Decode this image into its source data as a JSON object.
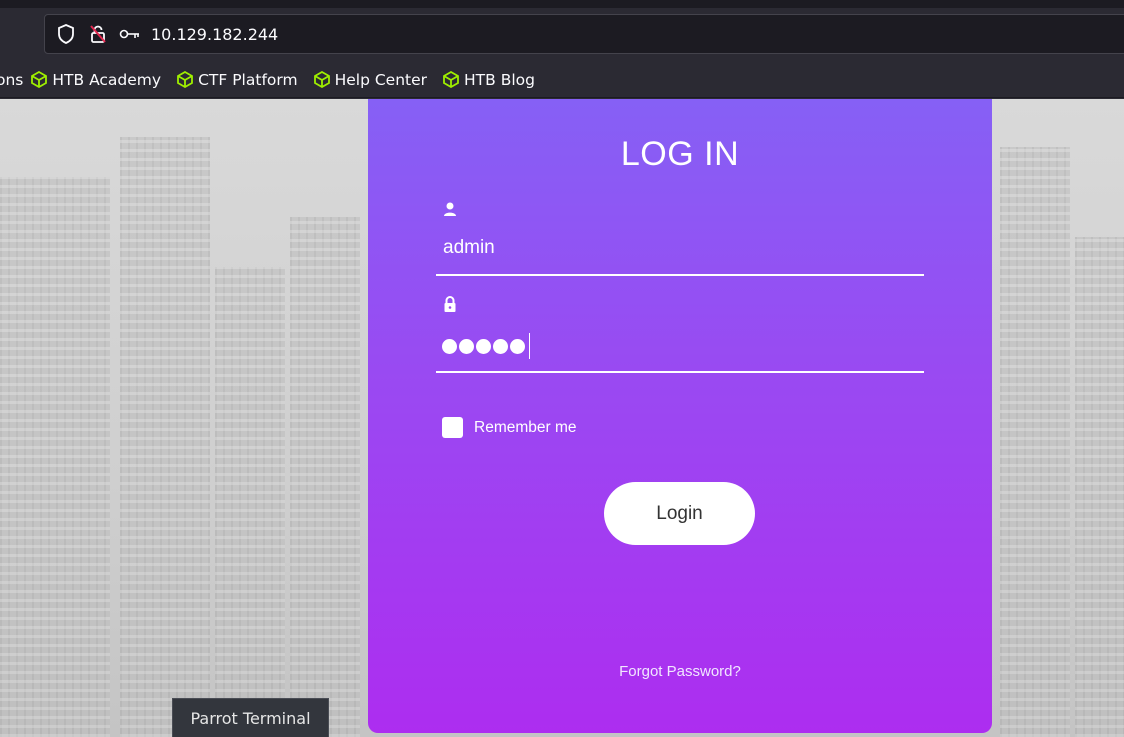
{
  "browser": {
    "url": "10.129.182.244",
    "bookmarks": [
      "ons",
      "HTB Academy",
      "CTF Platform",
      "Help Center",
      "HTB Blog"
    ],
    "bookmark_icon_color": "#9fef00"
  },
  "login": {
    "title": "LOG IN",
    "username_value": "admin",
    "password_masked": "●●●●●",
    "remember_label": "Remember me",
    "remember_checked": false,
    "login_button": "Login",
    "forgot_link": "Forgot Password?",
    "gradient_top": "#8660f5",
    "gradient_bottom": "#ad2df0"
  },
  "taskbar": {
    "tooltip": "Parrot Terminal"
  }
}
